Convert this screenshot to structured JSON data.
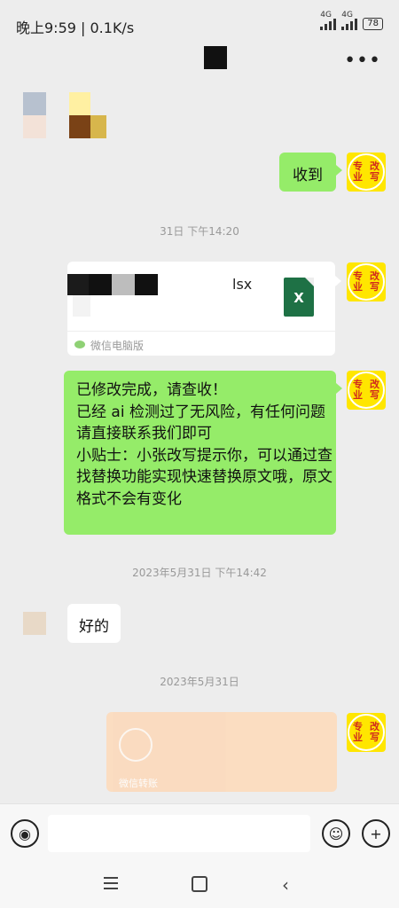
{
  "status_bar": {
    "time_speed": "晚上9:59 | 0.1K/s",
    "signal1": "4G",
    "signal2": "4G",
    "battery": "78"
  },
  "header": {
    "more_icon": "more-dots-icon"
  },
  "avatars": {
    "right_line1": "专业",
    "right_line2": "改写"
  },
  "messages": {
    "received_ok": "收到",
    "timestamp1": "31日 下午14:20",
    "file": {
      "name_suffix": "lsx",
      "icon_letter": "X",
      "source": "微信电脑版"
    },
    "long_message": "已修改完成，请查收！\n已经 ai 检测过了无风险，有任何问题请直接联系我们即可\n小贴士：小张改写提示你，可以通过查找替换功能实现快速替换原文哦，原文格式不会有变化",
    "timestamp2": "2023年5月31日 下午14:42",
    "reply": "好的",
    "timestamp3": "2023年5月31日",
    "transfer_label": "微信转账"
  },
  "input_bar": {
    "voice_icon": "voice-icon",
    "emoji_icon": "emoji-icon",
    "plus_icon": "plus-icon"
  },
  "nav_bar": {
    "menu_icon": "menu-icon",
    "home_icon": "home-icon",
    "back_icon": "back-icon"
  },
  "colors": {
    "background": "#ededed",
    "bubble_green": "#95ec69",
    "avatar_yellow": "#ffe600",
    "excel_green": "#1e7145"
  }
}
